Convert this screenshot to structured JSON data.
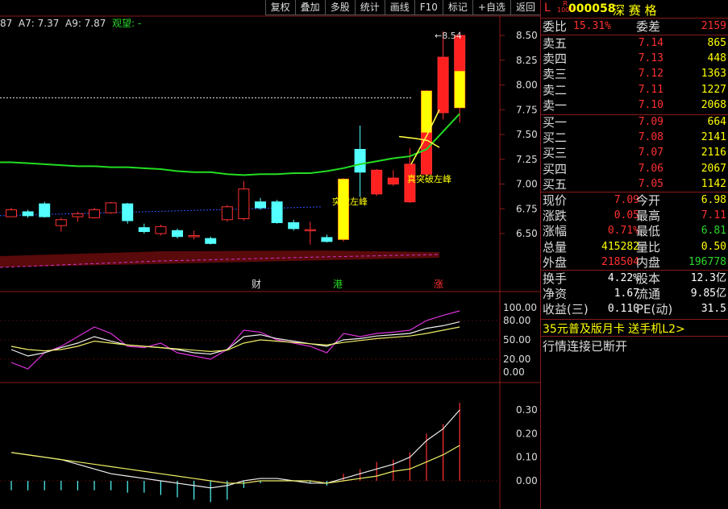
{
  "toolbar": [
    "复权",
    "叠加",
    "多股",
    "统计",
    "画线",
    "F10",
    "标记",
    "+自选",
    "返回"
  ],
  "indicator_line": {
    "prefix": "87",
    "a7": "A7: 7.37",
    "a9": "A9: 7.87",
    "status": "观望: -"
  },
  "price_axis": [
    "8.50",
    "8.25",
    "8.00",
    "7.75",
    "7.50",
    "7.25",
    "7.00",
    "6.75",
    "6.50"
  ],
  "high_label": "8.54",
  "annotations": {
    "break_left": "突破左峰",
    "break_right": "真突破左峰"
  },
  "event_markers": [
    "财",
    "港",
    "涨"
  ],
  "osc_axis": [
    "100.00",
    "80.00",
    "50.00",
    "20.00",
    "0.00"
  ],
  "macd_axis": [
    "0.30",
    "0.20",
    "0.10",
    "0.00"
  ],
  "stock": {
    "market": "L",
    "code": "000058",
    "name": "深 赛 格",
    "badge_top": "R",
    "badge_bottom": "1000"
  },
  "weibi": {
    "label": "委比",
    "value": "15.31%",
    "label2": "委差",
    "value2": "2159"
  },
  "sells": [
    {
      "label": "卖五",
      "price": "7.14",
      "vol": "865"
    },
    {
      "label": "卖四",
      "price": "7.13",
      "vol": "448"
    },
    {
      "label": "卖三",
      "price": "7.12",
      "vol": "1363"
    },
    {
      "label": "卖二",
      "price": "7.11",
      "vol": "1227"
    },
    {
      "label": "卖一",
      "price": "7.10",
      "vol": "2068"
    }
  ],
  "buys": [
    {
      "label": "买一",
      "price": "7.09",
      "vol": "664"
    },
    {
      "label": "买二",
      "price": "7.08",
      "vol": "2141"
    },
    {
      "label": "买三",
      "price": "7.07",
      "vol": "2116"
    },
    {
      "label": "买四",
      "price": "7.06",
      "vol": "2067"
    },
    {
      "label": "买五",
      "price": "7.05",
      "vol": "1142"
    }
  ],
  "quote": [
    {
      "l1": "现价",
      "v1": "7.09",
      "c1": "red",
      "l2": "今开",
      "v2": "6.98",
      "c2": "yel"
    },
    {
      "l1": "涨跌",
      "v1": "0.05",
      "c1": "red",
      "l2": "最高",
      "v2": "7.11",
      "c2": "red"
    },
    {
      "l1": "涨幅",
      "v1": "0.71%",
      "c1": "red",
      "l2": "最低",
      "v2": "6.81",
      "c2": "grn"
    },
    {
      "l1": "总量",
      "v1": "415282",
      "c1": "yel",
      "l2": "量比",
      "v2": "0.50",
      "c2": "yel"
    },
    {
      "l1": "外盘",
      "v1": "218504",
      "c1": "red",
      "l2": "内盘",
      "v2": "196778",
      "c2": "grn"
    }
  ],
  "stats": [
    {
      "l1": "换手",
      "v1": "4.22%",
      "l2": "股本",
      "v2": "12.3亿"
    },
    {
      "l1": "净资",
      "v1": "1.67",
      "l2": "流通",
      "v2": "9.85亿"
    },
    {
      "l1": "收益(三)",
      "v1": "0.110",
      "l2": "PE(动)",
      "v2": "31.5"
    }
  ],
  "promo": "35元普及版月卡 送手机L2>",
  "status": "行情连接已断开",
  "chart_data": {
    "type": "candlestick",
    "candles": [
      {
        "o": 6.67,
        "c": 6.74,
        "h": 6.76,
        "l": 6.67
      },
      {
        "o": 6.72,
        "c": 6.68,
        "h": 6.74,
        "l": 6.66
      },
      {
        "o": 6.8,
        "c": 6.67,
        "h": 6.82,
        "l": 6.66
      },
      {
        "o": 6.58,
        "c": 6.64,
        "h": 6.66,
        "l": 6.52
      },
      {
        "o": 6.67,
        "c": 6.7,
        "h": 6.72,
        "l": 6.62
      },
      {
        "o": 6.66,
        "c": 6.74,
        "h": 6.76,
        "l": 6.65
      },
      {
        "o": 6.71,
        "c": 6.81,
        "h": 6.82,
        "l": 6.7
      },
      {
        "o": 6.8,
        "c": 6.63,
        "h": 6.81,
        "l": 6.6
      },
      {
        "o": 6.56,
        "c": 6.52,
        "h": 6.6,
        "l": 6.5
      },
      {
        "o": 6.5,
        "c": 6.57,
        "h": 6.59,
        "l": 6.48
      },
      {
        "o": 6.53,
        "c": 6.47,
        "h": 6.55,
        "l": 6.45
      },
      {
        "o": 6.47,
        "c": 6.48,
        "h": 6.53,
        "l": 6.44
      },
      {
        "o": 6.45,
        "c": 6.4,
        "h": 6.47,
        "l": 6.39
      },
      {
        "o": 6.64,
        "c": 6.77,
        "h": 6.79,
        "l": 6.62
      },
      {
        "o": 6.65,
        "c": 6.95,
        "h": 7.03,
        "l": 6.63
      },
      {
        "o": 6.82,
        "c": 6.76,
        "h": 6.86,
        "l": 6.74
      },
      {
        "o": 6.82,
        "c": 6.61,
        "h": 6.84,
        "l": 6.6
      },
      {
        "o": 6.61,
        "c": 6.55,
        "h": 6.64,
        "l": 6.53
      },
      {
        "o": 6.54,
        "c": 6.54,
        "h": 6.62,
        "l": 6.39
      },
      {
        "o": 6.46,
        "c": 6.42,
        "h": 6.49,
        "l": 6.41
      },
      {
        "o": 6.44,
        "c": 7.05,
        "h": 7.06,
        "l": 6.42
      },
      {
        "o": 7.35,
        "c": 7.12,
        "h": 7.59,
        "l": 6.87
      },
      {
        "o": 6.9,
        "c": 7.14,
        "h": 7.15,
        "l": 6.88
      },
      {
        "o": 7.0,
        "c": 7.06,
        "h": 7.14,
        "l": 6.98
      },
      {
        "o": 6.82,
        "c": 7.2,
        "h": 7.36,
        "l": 6.81
      },
      {
        "o": 7.1,
        "c": 7.94,
        "h": 7.95,
        "l": 7.08
      },
      {
        "o": 7.72,
        "c": 8.28,
        "h": 8.54,
        "l": 7.65
      },
      {
        "o": 7.77,
        "c": 8.5,
        "h": 8.54,
        "l": 7.62
      }
    ],
    "ma_green": [
      7.22,
      7.21,
      7.2,
      7.19,
      7.18,
      7.18,
      7.17,
      7.17,
      7.16,
      7.15,
      7.13,
      7.12,
      7.12,
      7.1,
      7.09,
      7.1,
      7.1,
      7.11,
      7.11,
      7.13,
      7.16,
      7.2,
      7.23,
      7.26,
      7.28,
      7.35,
      7.53,
      7.71
    ]
  }
}
